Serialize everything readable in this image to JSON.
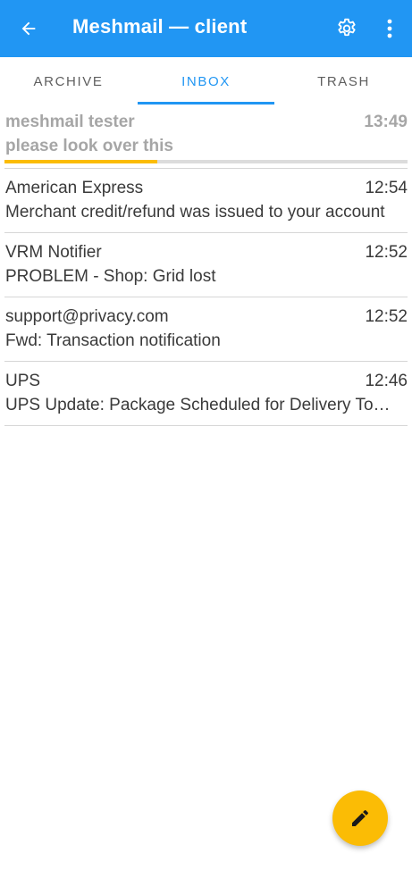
{
  "appbar": {
    "title": "Meshmail — client",
    "color": "#2196f3",
    "icons": [
      "back-arrow-icon",
      "gear-icon",
      "more-vert-icon"
    ]
  },
  "tabs": [
    {
      "label": "ARCHIVE",
      "active": false
    },
    {
      "label": "INBOX",
      "active": true
    },
    {
      "label": "TRASH",
      "active": false
    }
  ],
  "messages": [
    {
      "from": "meshmail tester",
      "time": "13:49",
      "subject": "please look over this",
      "sending": true,
      "progress": 0.38
    },
    {
      "from": "American Express",
      "time": "12:54",
      "subject": "Merchant credit/refund was issued to your account"
    },
    {
      "from": "VRM Notifier",
      "time": "12:52",
      "subject": "PROBLEM - Shop: Grid lost"
    },
    {
      "from": "support@privacy.com",
      "time": "12:52",
      "subject": "Fwd: Transaction notification"
    },
    {
      "from": "UPS",
      "time": "12:46",
      "subject": "UPS Update: Package Scheduled for Delivery Tomorrow"
    }
  ],
  "fab": {
    "icon": "pencil-icon",
    "color": "#fbbc05"
  },
  "colors": {
    "accent": "#2196f3",
    "progress": "#fbbc05"
  }
}
